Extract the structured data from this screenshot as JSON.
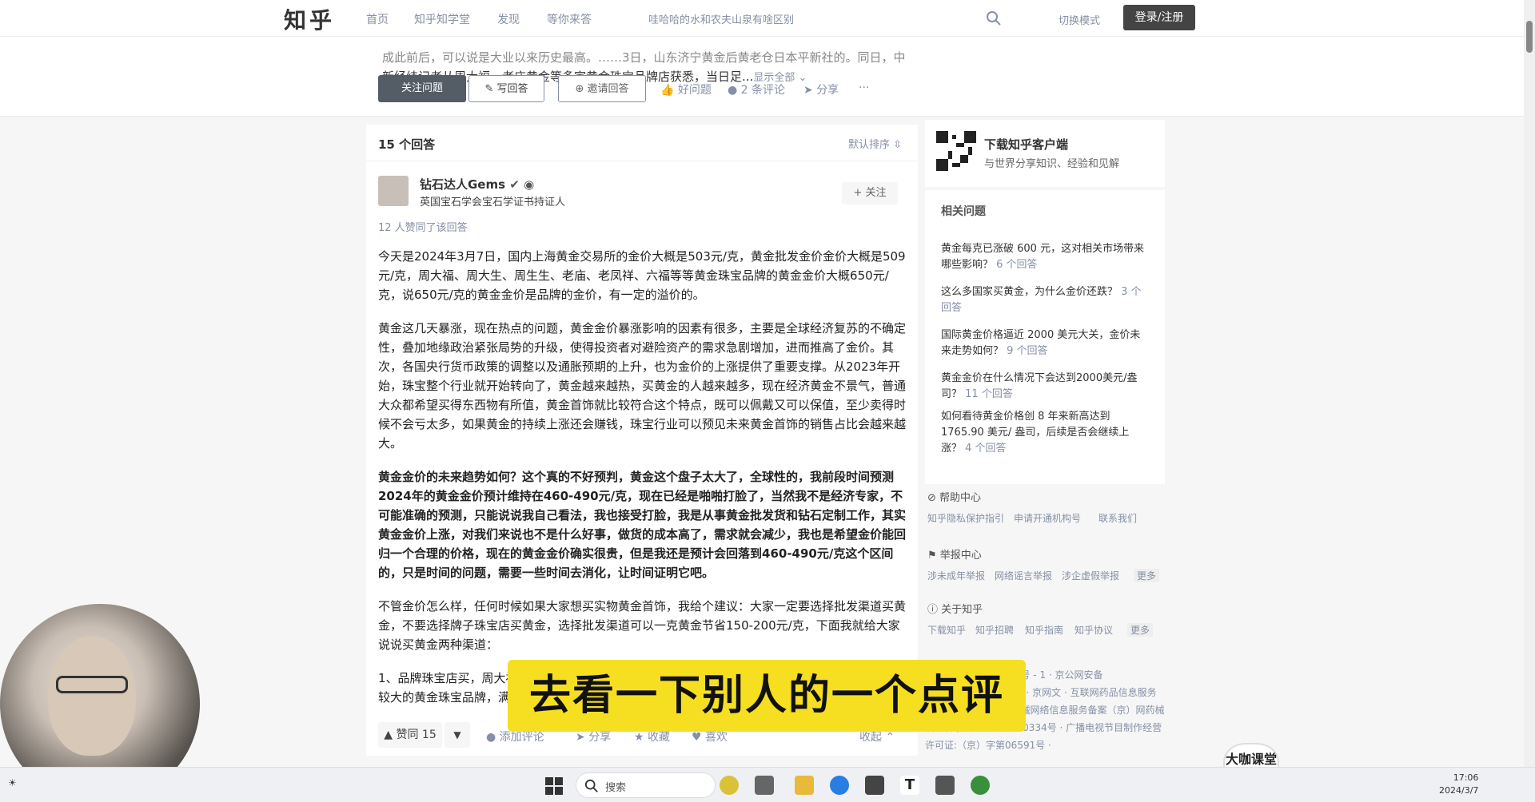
{
  "nav": {
    "logo": "知乎",
    "links": [
      "首页",
      "知乎知学堂",
      "发现",
      "等你来答"
    ],
    "search_placeholder": "哇哈哈的水和农夫山泉有啥区别",
    "switch_mode": "切换模式",
    "login": "登录/注册"
  },
  "question": {
    "excerpt_line1": "成此前后，可以说是大业以来历史最高。……3日，山东济宁黄金后黄老仓日本平新社的。同日，中",
    "excerpt_line2": "新经纬记者从周大福、老庙黄金等多家黄金珠宝品牌店获悉，当日足...",
    "show_all": "显示全部 ⌄",
    "follow": "关注问题",
    "write": "写回答",
    "invite": "邀请回答",
    "good_q": "好问题",
    "comments": "2 条评论",
    "share": "分享",
    "more": "···"
  },
  "answers": {
    "count": "15 个回答",
    "sort": "默认排序"
  },
  "answer": {
    "author": "钻石达人Gems",
    "bio": "英国宝石学会宝石学证书持证人",
    "follow": "+ 关注",
    "vote_info": "12 人赞同了该回答",
    "paragraphs": [
      "今天是2024年3月7日，国内上海黄金交易所的金价大概是503元/克，黄金批发金价金价大概是509元/克，周大福、周大生、周生生、老庙、老凤祥、六福等等黄金珠宝品牌的黄金金价大概650元/克，说650元/克的黄金金价是品牌的金价，有一定的溢价的。",
      "黄金这几天暴涨，现在热点的问题，黄金金价暴涨影响的因素有很多，主要是全球经济复苏的不确定性，叠加地缘政治紧张局势的升级，使得投资者对避险资产的需求急剧增加，进而推高了金价。其次，各国央行货币政策的调整以及通胀预期的上升，也为金价的上涨提供了重要支撑。从2023年开始，珠宝整个行业就开始转向了，黄金越来越热，买黄金的人越来越多，现在经济黄金不景气，普通大众都希望买得东西物有所值，黄金首饰就比较符合这个特点，既可以佩戴又可以保值，至少卖得时候不会亏太多，如果黄金的持续上涨还会赚钱，珠宝行业可以预见未来黄金首饰的销售占比会越来越大。",
      "黄金金价的未来趋势如何？这个真的不好预判，黄金这个盘子太大了，全球性的，我前段时间预测2024年的黄金金价预计维持在460-490元/克，现在已经是啪啪打脸了，当然我不是经济专家，不可能准确的预测，只能说说我自己看法，我也接受打脸，我是从事黄金批发货和钻石定制工作，其实黄金金价上涨，对我们来说也不是什么好事，做货的成本高了，需求就会减少，我也是希望金价能回归一个合理的价格，现在的黄金金价确实很贵，但是我还是预计会回落到460-490元/克这个区间的，只是时间的问题，需要一些时间去消化，让时间证明它吧。",
      "不管金价怎么样，任何时候如果大家想买实物黄金首饰，我给个建议：大家一定要选择批发渠道买黄金，不要选择牌子珠宝店买黄金，选择批发渠道可以一克黄金节省150-200元/克，下面我就给大家说说买黄金两种渠道：",
      "1、品牌珠宝店买，周大福、周大生、周生生、老庙、老凤祥、六福等等黄金珠宝品牌，这些都是比较大的黄金珠宝品牌，满大街都是"
    ],
    "upvote": "▲ 赞同 15",
    "downvote": "▼",
    "add_comment": "添加评论",
    "share": "分享",
    "collect": "收藏",
    "like": "喜欢",
    "collapse": "收起 ⌃"
  },
  "sidebar": {
    "app_title": "下载知乎客户端",
    "app_sub": "与世界分享知识、经验和见解",
    "related_title": "相关问题",
    "related": [
      {
        "q": "黄金每克已涨破 600 元，这对相关市场带来哪些影响？",
        "n": "6 个回答"
      },
      {
        "q": "这么多国家买黄金，为什么金价还跌？",
        "n": "3 个回答"
      },
      {
        "q": "国际黄金价格逼近 2000 美元大关，金价未来走势如何？",
        "n": "9 个回答"
      },
      {
        "q": "黄金金价在什么情况下会达到2000美元/盎司？",
        "n": "11 个回答"
      },
      {
        "q": "如何看待黄金价格创 8 年来新高达到 1765.90 美元/ 盎司，后续是否会继续上涨？",
        "n": "4 个回答"
      }
    ],
    "help_head": "帮助中心",
    "help_links": [
      "知乎隐私保护指引",
      "申请开通机构号",
      "联系我们"
    ],
    "report_head": "举报中心",
    "report_links": [
      "涉未成年举报",
      "网络谣言举报",
      "涉企虚假举报",
      "更多"
    ],
    "about_head": "关于知乎",
    "about_links": [
      "下载知乎",
      "知乎招聘",
      "知乎指南",
      "知乎协议",
      "更多"
    ],
    "icp": "京 ICP 备 13052560 号 - 1 · 京公网安备 11010802020088 号 · 京网文 · 互联网药品信息服务资格证书 · 药品医疗器械网络信息服务备案（京）网药械信息备字（2022）第00334号 · 广播电视节目制作经营许可证:（京）字第06591号 ·"
  },
  "overlay": {
    "subtitle": "去看一下别人的一个点评",
    "brand": "大咖课堂"
  },
  "taskbar": {
    "search": "搜索",
    "time": "17:06",
    "date": "2024/3/7"
  }
}
